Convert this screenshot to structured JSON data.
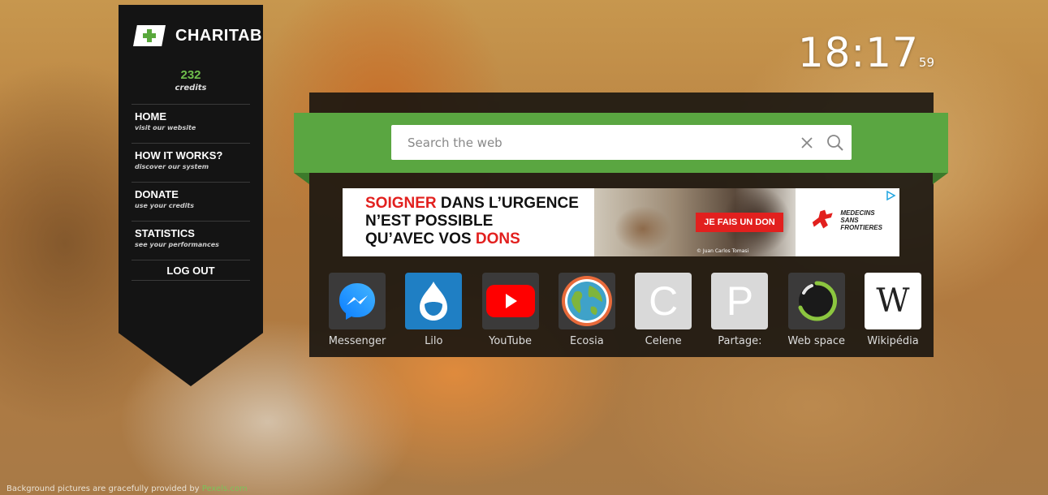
{
  "brand": {
    "name": "CHARITAB"
  },
  "credits": {
    "value": "232",
    "label": "credits"
  },
  "menu": [
    {
      "title": "HOME",
      "subtitle": "visit our website"
    },
    {
      "title": "HOW IT WORKS?",
      "subtitle": "discover our system"
    },
    {
      "title": "DONATE",
      "subtitle": "use your credits"
    },
    {
      "title": "STATISTICS",
      "subtitle": "see your performances"
    }
  ],
  "logout": "LOG OUT",
  "clock": {
    "time": "18:17",
    "seconds": "59"
  },
  "search": {
    "placeholder": "Search the web",
    "value": ""
  },
  "ad": {
    "line1_red": "SOIGNER",
    "line1_rest": " DANS L’URGENCE",
    "line2": "N’EST POSSIBLE",
    "line3_start": "QU’AVEC VOS ",
    "line3_red": "DONS",
    "cta": "JE FAIS UN DON",
    "photo_credit": "© Juan Carlos Tomasi",
    "logo_line1": "MEDECINS",
    "logo_line2": "SANS FRONTIERES"
  },
  "shortcuts": [
    {
      "label": "Messenger",
      "icon": "messenger-icon",
      "color": "#3b3a3a"
    },
    {
      "label": "Lilo",
      "icon": "lilo-icon",
      "color": "#1f7fc4"
    },
    {
      "label": "YouTube",
      "icon": "youtube-icon",
      "color": "#3b3a3a"
    },
    {
      "label": "Ecosia",
      "icon": "ecosia-icon",
      "color": "#3b3a3a"
    },
    {
      "label": "Celene",
      "icon": "letter-c-icon",
      "letter": "C",
      "color": "#d9d9d9"
    },
    {
      "label": "Partage:",
      "icon": "letter-p-icon",
      "letter": "P",
      "color": "#d9d9d9"
    },
    {
      "label": "Web space",
      "icon": "webspace-icon",
      "color": "#3b3a3a"
    },
    {
      "label": "Wikipédia",
      "icon": "wikipedia-icon",
      "color": "#ffffff"
    }
  ],
  "footer": {
    "text": "Background pictures are gracefully provided by ",
    "link": "Pexels.com"
  },
  "colors": {
    "accent_green": "#5aa641",
    "credits_green": "#6fbf4c",
    "sidebar": "#141414",
    "ad_red": "#e2201e"
  }
}
